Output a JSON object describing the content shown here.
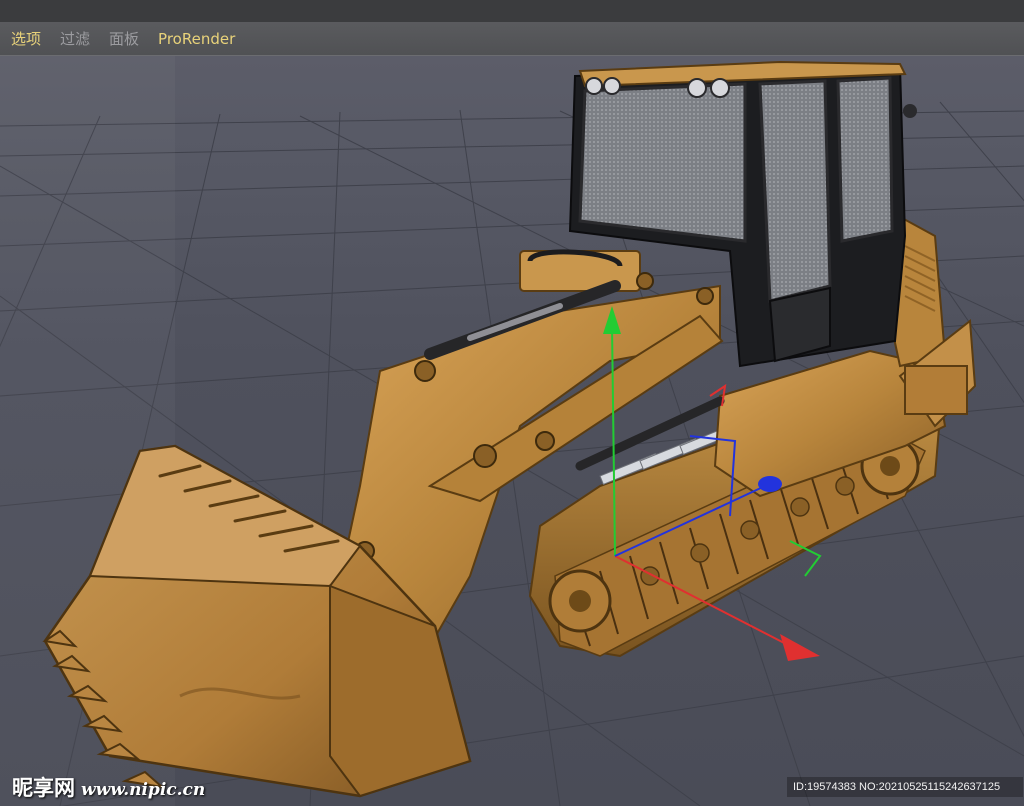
{
  "window": {
    "title": ""
  },
  "menu": {
    "items": [
      {
        "label": "选项",
        "active": true
      },
      {
        "label": "过滤",
        "active": false
      },
      {
        "label": "面板",
        "active": false
      },
      {
        "label": "ProRender",
        "active": false
      }
    ]
  },
  "viewport": {
    "object": "track-loader-bulldozer",
    "gizmo": {
      "x_axis_color": "#e03030",
      "y_axis_color": "#22cc33",
      "z_axis_color": "#2233dd"
    }
  },
  "watermark": {
    "brand": "昵享网",
    "url": "www.nipic.cn",
    "id_text": "ID:19574383 NO:20210525115242637125"
  },
  "colors": {
    "menu_accent": "#e8d27a",
    "grid_bg": "#4e505c",
    "model_body": "#c08a3e"
  }
}
